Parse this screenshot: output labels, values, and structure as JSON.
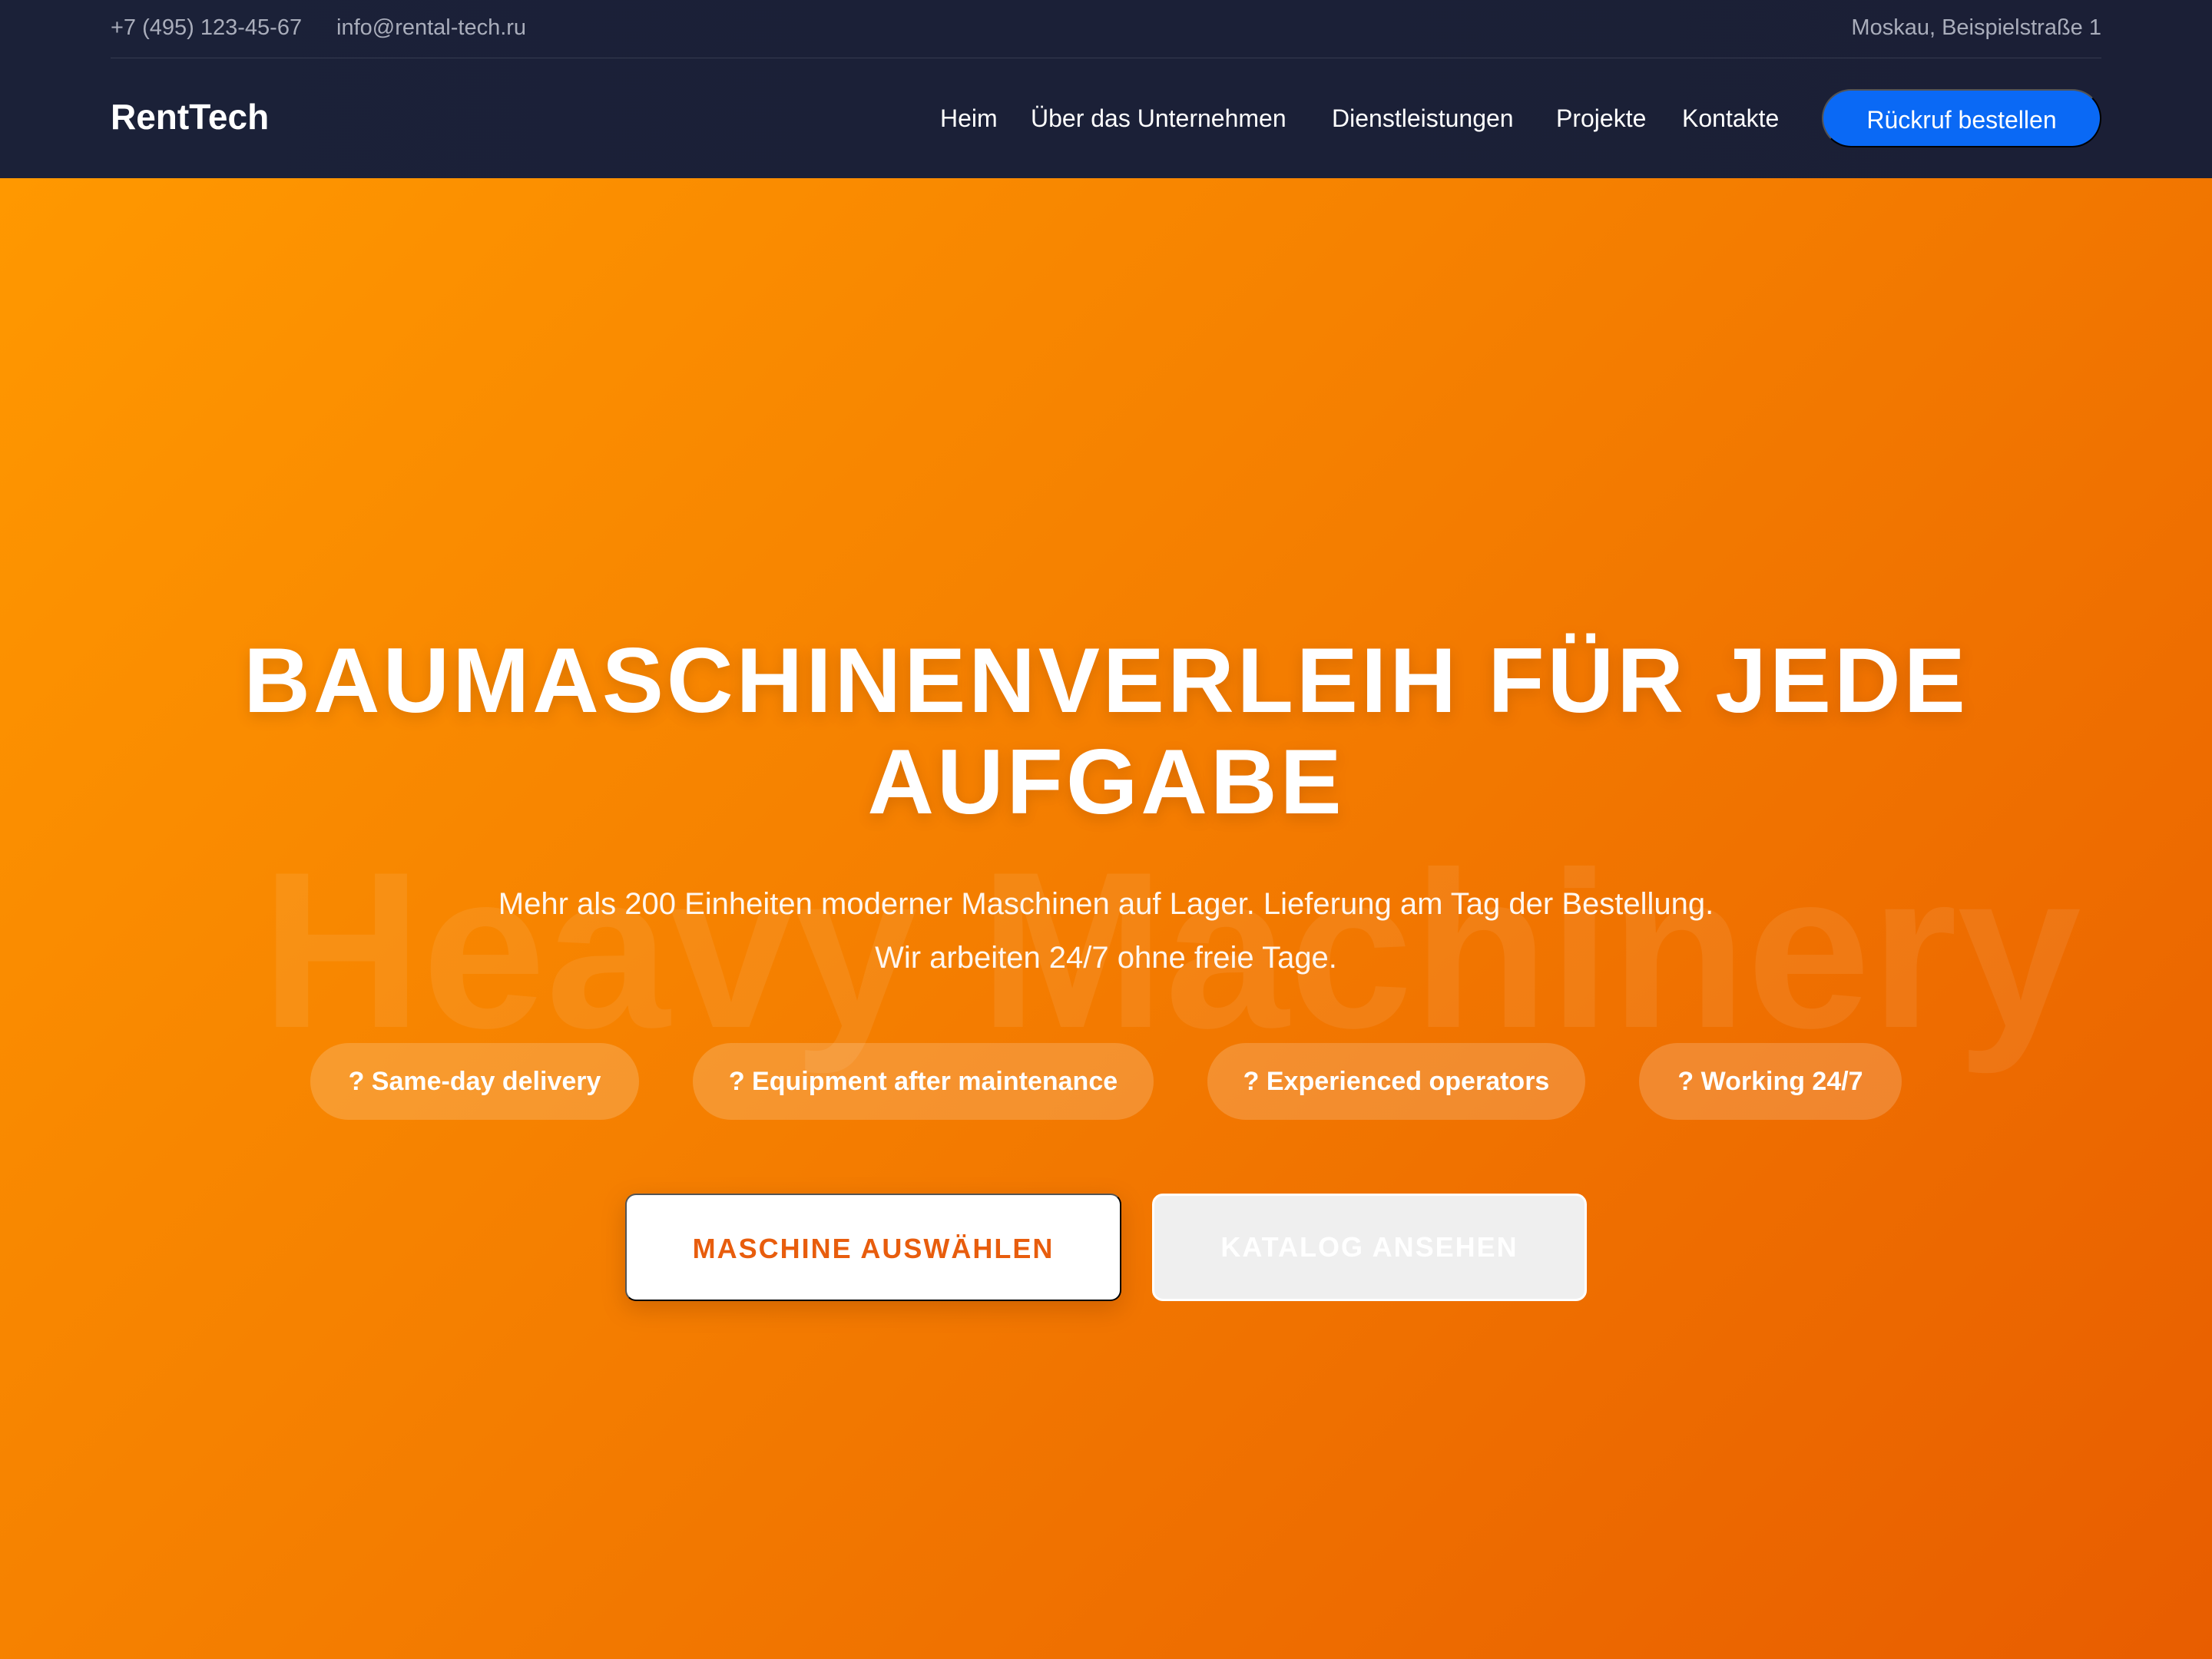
{
  "header": {
    "topbar": {
      "phone": "+7 (495) 123-45-67",
      "email": "info@rental-tech.ru",
      "address": "Moskau, Beispielstraße 1"
    },
    "logo": "RentTech",
    "nav": {
      "home": "Heim",
      "about": "Über das Unternehmen",
      "services": "Dienstleistungen",
      "projects": "Projekte",
      "contacts": "Kontakte"
    },
    "callback_button": "Rückruf bestellen"
  },
  "hero": {
    "watermark": "Heavy Machinery",
    "title": "BAUMASCHINENVERLEIH FÜR JEDE AUFGABE",
    "subtitle": "Mehr als 200 Einheiten moderner Maschinen auf Lager. Lieferung am Tag der Bestellung. Wir arbeiten 24/7 ohne freie Tage.",
    "features": [
      "? Same-day delivery",
      "? Equipment after maintenance",
      "? Experienced operators",
      "? Working 24/7"
    ],
    "buttons": {
      "primary": "MASCHINE AUSWÄHLEN",
      "secondary": "KATALOG ANSEHEN"
    }
  },
  "colors": {
    "header_background": "#1b2138",
    "accent_blue": "#0a69f5",
    "hero_orange_start": "#ff9800",
    "hero_orange_end": "#e85d00",
    "primary_button_text": "#e85d0d"
  }
}
